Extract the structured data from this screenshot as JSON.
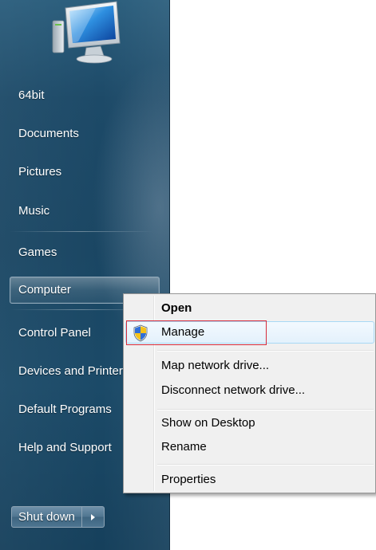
{
  "start_menu": {
    "user_picture_icon": "computer-monitor-icon",
    "items": [
      {
        "label": "64bit"
      },
      {
        "label": "Documents"
      },
      {
        "label": "Pictures"
      },
      {
        "label": "Music"
      },
      {
        "label": "Games"
      },
      {
        "label": "Computer",
        "highlighted": true
      },
      {
        "label": "Control Panel"
      },
      {
        "label": "Devices and Printers"
      },
      {
        "label": "Default Programs"
      },
      {
        "label": "Help and Support"
      }
    ],
    "shutdown": {
      "label": "Shut down",
      "arrow_icon": "arrow-right-icon"
    }
  },
  "context_menu": {
    "items": [
      {
        "label": "Open",
        "bold": true
      },
      {
        "label": "Manage",
        "icon": "uac-shield-icon",
        "hover": true
      },
      {
        "label": "Map network drive..."
      },
      {
        "label": "Disconnect network drive..."
      },
      {
        "label": "Show on Desktop"
      },
      {
        "label": "Rename"
      },
      {
        "label": "Properties"
      }
    ]
  },
  "annotation": {
    "highlight_color": "#d62b3b",
    "highlighted_item": "Manage"
  }
}
